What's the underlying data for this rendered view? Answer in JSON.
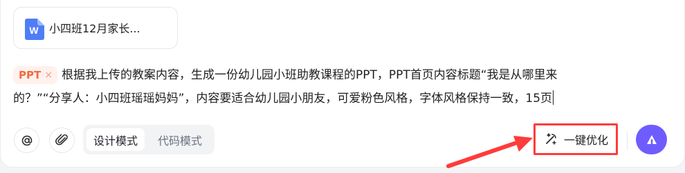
{
  "attachment": {
    "icon": "word-document-icon",
    "name": "小四班12月家长..."
  },
  "prompt": {
    "tag_label": "PPT",
    "tag_remove_icon": "×",
    "line_1": "根据我上传的教案内容，生成一份幼儿园小班助教课程的PPT，PPT首页内容标题“我是从哪里来",
    "line_2": "的？”“分享人：小四班瑶瑶妈妈”，内容要适合幼儿园小朋友，可爱粉色风格，字体风格保持一致，15页"
  },
  "toolbar": {
    "mention_icon": "at-icon",
    "attachment_icon": "paperclip-icon",
    "mode_design": "设计模式",
    "mode_code": "代码模式",
    "optimize_label": "一键优化",
    "optimize_icon": "magic-pen-icon",
    "send_icon": "send-arrow-icon"
  },
  "colors": {
    "accent": "#6f5cff",
    "highlight": "#ff3b3b",
    "tag_bg": "#fff1ee",
    "tag_text": "#f06b3f"
  }
}
